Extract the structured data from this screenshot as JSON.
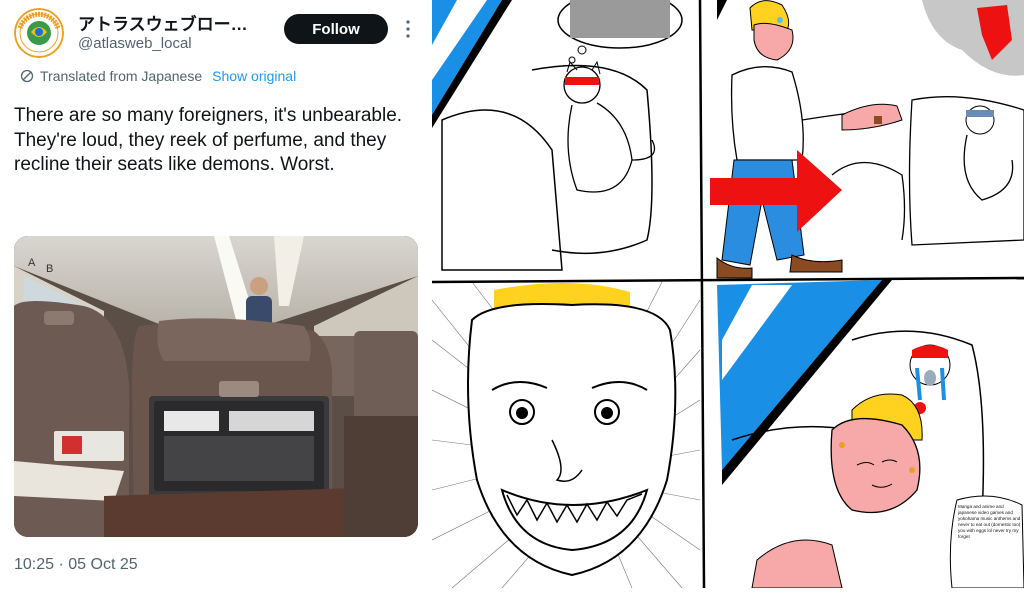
{
  "tweet": {
    "avatar_text": "ATLAS WEB GUIDE",
    "display_name": "アトラスウェブロー…",
    "handle": "@atlasweb_local",
    "follow_label": "Follow",
    "more_icon": "more-dots-icon",
    "translated_label": "Translated from Japanese",
    "show_original_label": "Show original",
    "text": "There are so many foreigners, it's unbearable. They're loud, they reek of perfume, and they recline their seats like demons. Worst.",
    "photo_sign_letters": [
      "A",
      "B"
    ],
    "timestamp": "10:25 · 05 Oct 25"
  },
  "comic": {
    "panel4_note": "Manga and anime and japanese video games and yokohama music anthems and never to eat out (domestic too) you with eggs lol never try my forget",
    "colors": {
      "blonde": "#ffd21f",
      "sky": "#1a8fe6",
      "arrow": "#ee1111",
      "skin": "#f7a8a8",
      "pants": "#2b8de0",
      "shoes": "#8a4a22"
    }
  },
  "colors": {
    "follow_bg": "#0f1419",
    "link": "#1d9bf0",
    "text": "#0f1419",
    "muted": "#536471"
  }
}
